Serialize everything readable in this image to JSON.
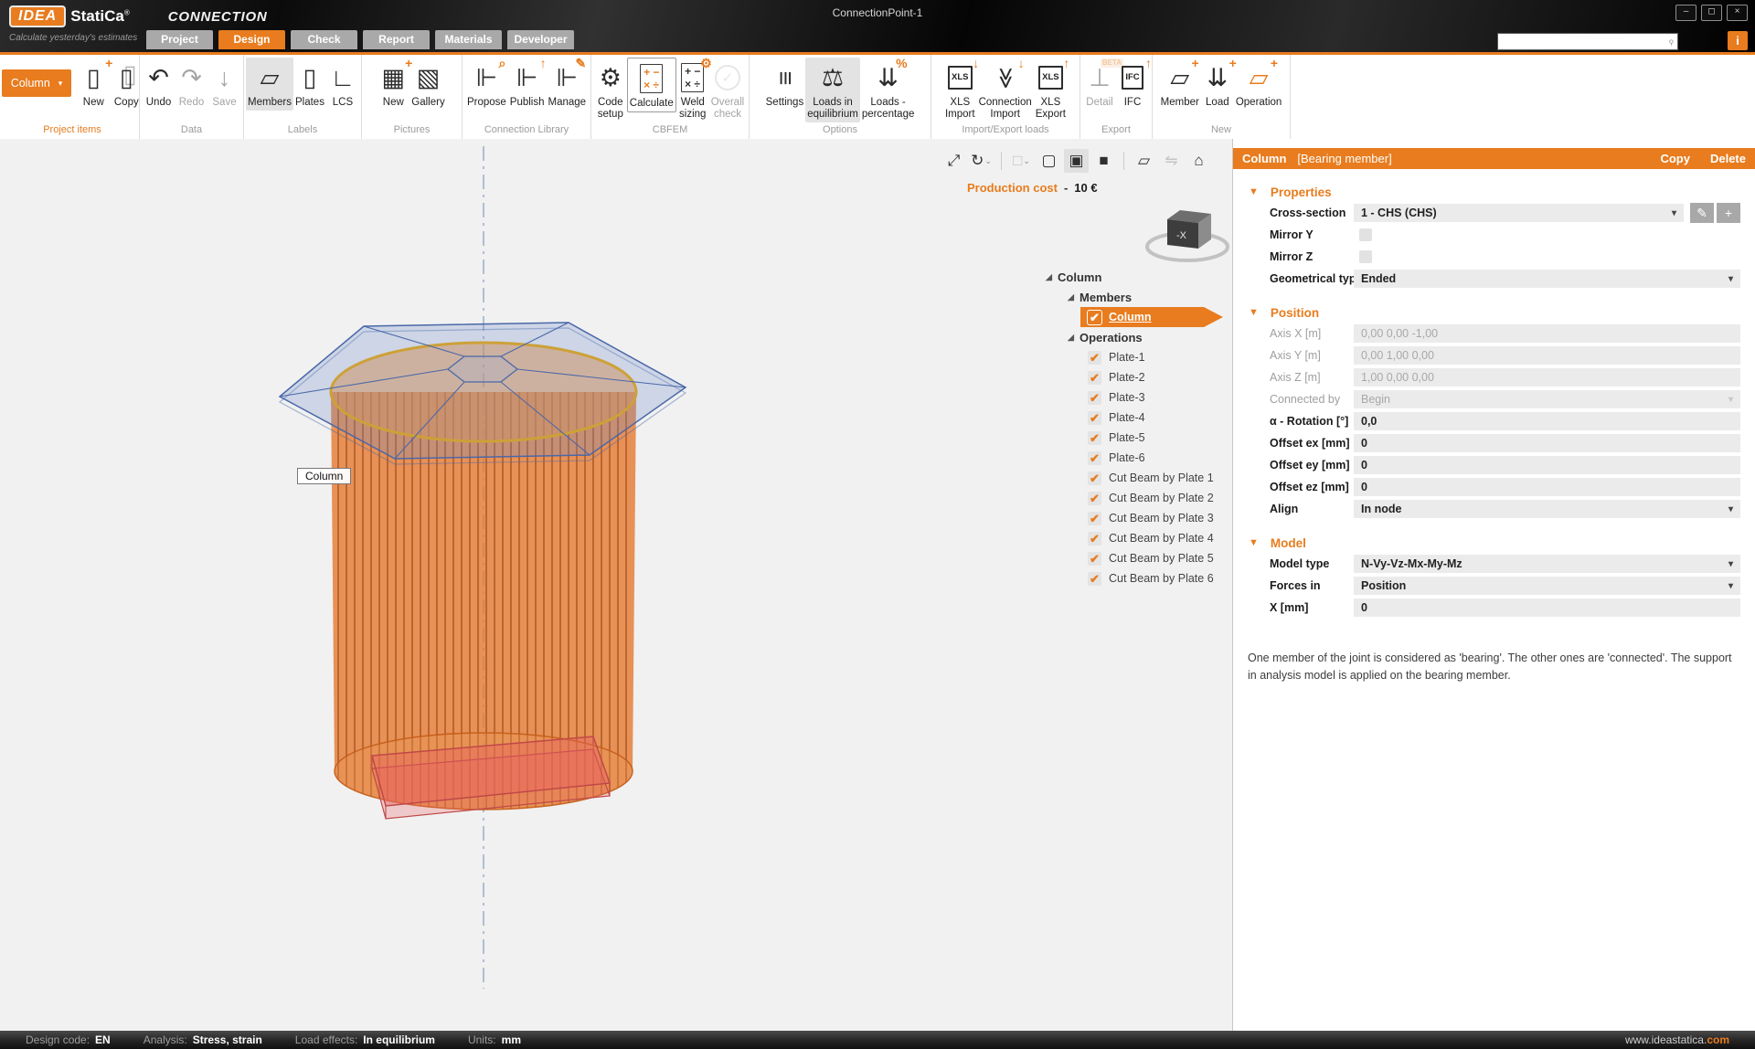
{
  "colors": {
    "accent": "#e87c1e",
    "rim-yellow": "#f2a900",
    "cylinder-orange": "#e4762c",
    "plate-blue": "#4a68a8",
    "plate-red": "#c04848"
  },
  "titlebar": {
    "brand_idea": "IDEA",
    "brand_statica": "StatiCa",
    "brand_reg": "®",
    "product": "CONNECTION",
    "tagline": "Calculate yesterday's estimates",
    "title": "ConnectionPoint-1",
    "info_label": "i",
    "window_buttons": [
      {
        "name": "minimize-button",
        "glyph": "–"
      },
      {
        "name": "maximize-button",
        "glyph": "◻"
      },
      {
        "name": "close-button",
        "glyph": "×"
      }
    ]
  },
  "search": {
    "placeholder": ""
  },
  "tabs": [
    {
      "label": "Project"
    },
    {
      "label": "Design",
      "active": true
    },
    {
      "label": "Check"
    },
    {
      "label": "Report"
    },
    {
      "label": "Materials"
    },
    {
      "label": "Developer"
    }
  ],
  "ribbon": {
    "groups": [
      {
        "label": "Project items",
        "accent": true,
        "items": [
          {
            "kind": "selector",
            "label": "Column"
          },
          {
            "label": "New",
            "icon": "new-project-item",
            "glyph": "▯",
            "badge": "+"
          },
          {
            "label": "Copy",
            "icon": "copy-project-item",
            "glyph": "▯",
            "cls": "copysh"
          }
        ]
      },
      {
        "label": "Data",
        "items": [
          {
            "label": "Undo",
            "icon": "undo",
            "glyph": "↶"
          },
          {
            "label": "Redo",
            "icon": "redo",
            "glyph": "↷",
            "disabled": true
          },
          {
            "label": "Save",
            "icon": "save",
            "glyph": "↓",
            "disabled": true
          }
        ]
      },
      {
        "label": "Labels",
        "items": [
          {
            "label": "Members",
            "icon": "members",
            "glyph": "▱",
            "selected": true
          },
          {
            "label": "Plates",
            "icon": "plates",
            "glyph": "▯"
          },
          {
            "label": "LCS",
            "icon": "lcs",
            "glyph": "∟"
          }
        ]
      },
      {
        "label": "Pictures",
        "items": [
          {
            "label": "New",
            "icon": "new-picture",
            "glyph": "▦",
            "badge": "+"
          },
          {
            "label": "Gallery",
            "icon": "gallery",
            "glyph": "▧"
          }
        ]
      },
      {
        "label": "Connection Library",
        "items": [
          {
            "label": "Propose",
            "icon": "propose-connection",
            "glyph": "⊩",
            "badge": "⌕",
            "badge_name": "magnifier-badge"
          },
          {
            "label": "Publish",
            "icon": "publish-connection",
            "glyph": "⊩",
            "badge": "↑",
            "badge_name": "upload-badge"
          },
          {
            "label": "Manage",
            "icon": "manage-connection",
            "glyph": "⊩",
            "badge": "✎",
            "badge_name": "pencil-badge"
          }
        ]
      },
      {
        "label": "CBFEM",
        "items": [
          {
            "label": "Code\nsetup",
            "icon": "code-setup",
            "glyph": "⚙"
          },
          {
            "label": "Calculate",
            "icon": "calculate",
            "glyph": "+ −\n× ÷",
            "cls": "grid grid-a",
            "boxed": true
          },
          {
            "label": "Weld\nsizing",
            "icon": "weld-sizing",
            "glyph": "+ −\n× ÷",
            "cls": "grid",
            "badge": "⚙",
            "badge_name": "gear-badge"
          },
          {
            "label": "Overall\ncheck",
            "icon": "overall-check",
            "glyph": "✓",
            "cls": "circ",
            "disabled": true
          }
        ]
      },
      {
        "label": "Options",
        "items": [
          {
            "label": "Settings",
            "icon": "settings",
            "glyph": "≡",
            "cls": "rot90"
          },
          {
            "label": "Loads in\nequilibrium",
            "icon": "loads-in-equilibrium",
            "glyph": "⚖",
            "selected": true
          },
          {
            "label": "Loads -\npercentage",
            "icon": "loads-percentage",
            "glyph": "⇊",
            "badge": "%",
            "badge_name": "percent-badge"
          }
        ]
      },
      {
        "label": "Import/Export loads",
        "items": [
          {
            "label": "XLS\nImport",
            "icon": "xls-import",
            "glyph": "XLS",
            "cls": "doc",
            "badge": "↓",
            "badge_name": "download-badge"
          },
          {
            "label": "Connection\nImport",
            "icon": "connection-import",
            "glyph": "≪",
            "cls": "rotm90",
            "badge": "↓",
            "badge_name": "download-badge"
          },
          {
            "label": "XLS\nExport",
            "icon": "xls-export",
            "glyph": "XLS",
            "cls": "doc",
            "badge": "↑",
            "badge_name": "upload-badge"
          }
        ]
      },
      {
        "label": "Export",
        "items": [
          {
            "label": "Detail",
            "icon": "detail-export",
            "glyph": "⊥",
            "disabled": true,
            "badge": "BETA",
            "badgecls": "beta",
            "badge_name": "beta-badge"
          },
          {
            "label": "IFC",
            "icon": "ifc-export",
            "glyph": "IFC",
            "cls": "doc",
            "badge": "↑",
            "badge_name": "upload-badge"
          }
        ]
      },
      {
        "label": "New",
        "items": [
          {
            "label": "Member",
            "icon": "new-member",
            "glyph": "▱",
            "badge": "+"
          },
          {
            "label": "Load",
            "icon": "new-load",
            "glyph": "⇊",
            "badge": "+"
          },
          {
            "label": "Operation",
            "icon": "new-operation",
            "glyph": "▱",
            "cls": "op",
            "badge": "+"
          }
        ]
      }
    ]
  },
  "viewport": {
    "production_cost": {
      "label": "Production cost",
      "sep": "-",
      "value": "10 €"
    },
    "scene_label": "Column",
    "nav_cube_label": "-X",
    "toolbar": [
      {
        "name": "zoom-fit",
        "glyph": "⤢"
      },
      {
        "name": "rotate-view",
        "glyph": "↻",
        "caret": true
      },
      {
        "sep": true
      },
      {
        "name": "selection-mode",
        "glyph": "□",
        "caret": true,
        "disabled": true
      },
      {
        "name": "wireframe-view",
        "glyph": "▢"
      },
      {
        "name": "transparent-view",
        "glyph": "▣",
        "selected": true
      },
      {
        "name": "solid-view",
        "glyph": "■"
      },
      {
        "sep": true
      },
      {
        "name": "plate-view",
        "glyph": "▱"
      },
      {
        "name": "mirror-view",
        "glyph": "⇋",
        "disabled": true
      },
      {
        "name": "home-view",
        "glyph": "⌂"
      }
    ]
  },
  "tree": {
    "root_label": "Column",
    "groups": [
      {
        "label": "Members",
        "items": [
          {
            "label": "Column",
            "checked": true,
            "selected": true
          }
        ]
      },
      {
        "label": "Operations",
        "items": [
          {
            "label": "Plate-1",
            "checked": true
          },
          {
            "label": "Plate-2",
            "checked": true
          },
          {
            "label": "Plate-3",
            "checked": true
          },
          {
            "label": "Plate-4",
            "checked": true
          },
          {
            "label": "Plate-5",
            "checked": true
          },
          {
            "label": "Plate-6",
            "checked": true
          },
          {
            "label": "Cut Beam by Plate 1",
            "checked": true
          },
          {
            "label": "Cut Beam by Plate 2",
            "checked": true
          },
          {
            "label": "Cut Beam by Plate 3",
            "checked": true
          },
          {
            "label": "Cut Beam by Plate 4",
            "checked": true
          },
          {
            "label": "Cut Beam by Plate 5",
            "checked": true
          },
          {
            "label": "Cut Beam by Plate 6",
            "checked": true
          }
        ]
      }
    ]
  },
  "panel": {
    "header": {
      "title": "Column",
      "subtitle": "[Bearing member]",
      "copy_label": "Copy",
      "delete_label": "Delete"
    },
    "sections": [
      {
        "title": "Properties",
        "rows": [
          {
            "label": "Cross-section",
            "type": "dropdown",
            "value": "1 - CHS (CHS)",
            "extras": [
              "edit",
              "add"
            ]
          },
          {
            "label": "Mirror Y",
            "type": "checkbox",
            "checked": false
          },
          {
            "label": "Mirror Z",
            "type": "checkbox",
            "checked": false
          },
          {
            "label": "Geometrical type",
            "type": "dropdown",
            "value": "Ended"
          }
        ]
      },
      {
        "title": "Position",
        "rows": [
          {
            "label": "Axis X [m]",
            "type": "text",
            "value": "0,00 0,00 -1,00",
            "disabled": true
          },
          {
            "label": "Axis Y [m]",
            "type": "text",
            "value": "0,00 1,00 0,00",
            "disabled": true
          },
          {
            "label": "Axis Z [m]",
            "type": "text",
            "value": "1,00 0,00 0,00",
            "disabled": true
          },
          {
            "label": "Connected by",
            "type": "dropdown",
            "value": "Begin",
            "disabled": true
          },
          {
            "label": "α - Rotation [°]",
            "type": "text",
            "value": "0,0"
          },
          {
            "label": "Offset ex [mm]",
            "type": "text",
            "value": "0"
          },
          {
            "label": "Offset ey [mm]",
            "type": "text",
            "value": "0"
          },
          {
            "label": "Offset ez [mm]",
            "type": "text",
            "value": "0"
          },
          {
            "label": "Align",
            "type": "dropdown",
            "value": "In node"
          }
        ]
      },
      {
        "title": "Model",
        "rows": [
          {
            "label": "Model type",
            "type": "dropdown",
            "value": "N-Vy-Vz-Mx-My-Mz"
          },
          {
            "label": "Forces in",
            "type": "dropdown",
            "value": "Position"
          },
          {
            "label": "X [mm]",
            "type": "text",
            "value": "0"
          }
        ]
      }
    ],
    "note": "One member of the joint is considered as 'bearing'. The other ones are 'connected'. The support in analysis model is applied on the bearing member."
  },
  "statusbar": {
    "items": [
      {
        "label": "Design code:",
        "value": "EN"
      },
      {
        "label": "Analysis:",
        "value": "Stress, strain"
      },
      {
        "label": "Load effects:",
        "value": "In equilibrium"
      },
      {
        "label": "Units:",
        "value": "mm"
      }
    ],
    "website_prefix": "www.ideastatica.",
    "website_suffix": "com"
  }
}
